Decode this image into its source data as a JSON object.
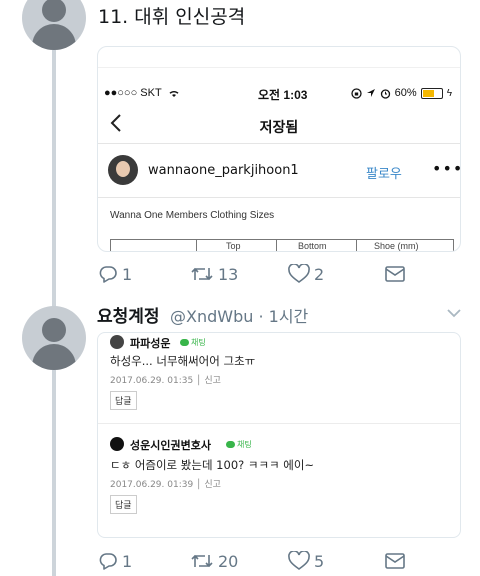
{
  "tweet1": {
    "text": "11. 대휘 인신공격",
    "embedded_screenshot": {
      "carrier": "●●○○○ SKT",
      "time": "오전 1:03",
      "battery": "60%",
      "battery_level": 0.6,
      "nav_title": "저장됨",
      "username": "wannaone_parkjihoon1",
      "follow_label": "팔로우",
      "more": "•••",
      "image_title": "Wanna One Members Clothing Sizes",
      "table_headers": [
        "",
        "Top",
        "Bottom",
        "Shoe (mm)"
      ]
    },
    "actions": {
      "replies": "1",
      "retweets": "13",
      "likes": "2"
    }
  },
  "tweet2": {
    "name": "요청계정",
    "handle": "@XndWbu · 1시간",
    "comments": [
      {
        "author": "파파성운",
        "badge": "채팅",
        "text": "하성우... 너무해써어어 그초ㅠ",
        "meta": "2017.06.29. 01:35 │ 신고",
        "reply": "답글"
      },
      {
        "author": "성운시인권변호사",
        "badge": "채팅",
        "text": "ㄷㅎ 어즘이로 봤는데 100? ㅋㅋㅋ 에이~",
        "meta": "2017.06.29. 01:39 │ 신고",
        "reply": "답글"
      }
    ],
    "actions": {
      "replies": "1",
      "retweets": "20",
      "likes": "5"
    }
  },
  "colors": {
    "muted": "#657786",
    "follow": "#3b88c9",
    "chat_green": "#38b54a"
  }
}
